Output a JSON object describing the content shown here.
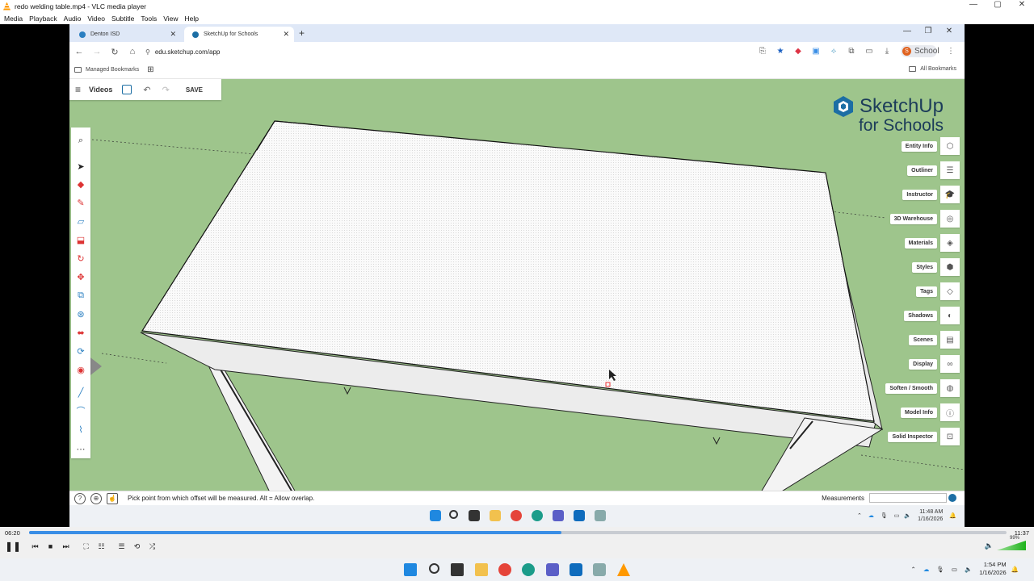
{
  "vlc": {
    "window_title": "redo welding table.mp4 - VLC media player",
    "menu": [
      "Media",
      "Playback",
      "Audio",
      "Video",
      "Subtitle",
      "Tools",
      "View",
      "Help"
    ],
    "elapsed": "06:20",
    "total": "11:37",
    "progress_fraction": 0.545,
    "volume_percent": "99%"
  },
  "browser": {
    "tabs": [
      {
        "label": "Denton ISD",
        "active": false
      },
      {
        "label": "SketchUp for Schools",
        "active": true
      }
    ],
    "url": "edu.sketchup.com/app",
    "profile_label": "School",
    "profile_initial": "S",
    "bookmarks_left": "Managed Bookmarks",
    "bookmarks_right": "All Bookmarks"
  },
  "sketchup": {
    "topbar": {
      "menu_label": "Videos",
      "save_label": "SAVE"
    },
    "brand_line1": "SketchUp",
    "brand_line2": "for Schools",
    "panels": [
      {
        "label": "Entity Info",
        "icon": "entity-info-icon",
        "glyph": "⬡"
      },
      {
        "label": "Outliner",
        "icon": "outliner-icon",
        "glyph": "☰"
      },
      {
        "label": "Instructor",
        "icon": "instructor-icon",
        "glyph": "🎓"
      },
      {
        "label": "3D Warehouse",
        "icon": "warehouse-icon",
        "glyph": "◎"
      },
      {
        "label": "Materials",
        "icon": "materials-icon",
        "glyph": "◈"
      },
      {
        "label": "Styles",
        "icon": "styles-icon",
        "glyph": "⬢"
      },
      {
        "label": "Tags",
        "icon": "tags-icon",
        "glyph": "◇"
      },
      {
        "label": "Shadows",
        "icon": "shadows-icon",
        "glyph": "◐"
      },
      {
        "label": "Scenes",
        "icon": "scenes-icon",
        "glyph": "▤"
      },
      {
        "label": "Display",
        "icon": "display-icon",
        "glyph": "∞"
      },
      {
        "label": "Soften / Smooth",
        "icon": "soften-icon",
        "glyph": "◍"
      },
      {
        "label": "Model Info",
        "icon": "model-info-icon",
        "glyph": "ⓘ"
      },
      {
        "label": "Solid Inspector",
        "icon": "solid-inspector-icon",
        "glyph": "⊡"
      }
    ],
    "tools": [
      {
        "name": "search-tool-icon",
        "glyph": "⌕",
        "color": "#333"
      },
      {
        "name": "select-tool-icon",
        "glyph": "➤",
        "color": "#222"
      },
      {
        "name": "eraser-tool-icon",
        "glyph": "◆",
        "color": "#d33"
      },
      {
        "name": "pencil-tool-icon",
        "glyph": "✎",
        "color": "#d33"
      },
      {
        "name": "rectangle-tool-icon",
        "glyph": "▱",
        "color": "#2a7fc1"
      },
      {
        "name": "push-pull-tool-icon",
        "glyph": "⬓",
        "color": "#d33"
      },
      {
        "name": "rotate-tool-icon",
        "glyph": "↻",
        "color": "#d33"
      },
      {
        "name": "move-tool-icon",
        "glyph": "✥",
        "color": "#d33"
      },
      {
        "name": "scale-tool-icon",
        "glyph": "⧉",
        "color": "#2a7fc1"
      },
      {
        "name": "offset-tool-icon",
        "glyph": "⊛",
        "color": "#2a7fc1"
      },
      {
        "name": "section-plane-tool-icon",
        "glyph": "⬌",
        "color": "#d33"
      },
      {
        "name": "orbit-tool-icon",
        "glyph": "⟳",
        "color": "#2a7fc1"
      },
      {
        "name": "paint-tool-icon",
        "glyph": "◉",
        "color": "#d33"
      },
      {
        "name": "line-tool-icon",
        "glyph": "╱",
        "color": "#2a7fc1"
      },
      {
        "name": "arc-tool-icon",
        "glyph": "⌒",
        "color": "#2a7fc1"
      },
      {
        "name": "freehand-tool-icon",
        "glyph": "⌇",
        "color": "#2a7fc1"
      },
      {
        "name": "more-tools-icon",
        "glyph": "⋯",
        "color": "#555"
      }
    ],
    "status_message": "Pick point from which offset will be measured. Alt = Allow overlap.",
    "measurements_label": "Measurements"
  },
  "inner_taskbar": {
    "time": "11:48 AM",
    "date": "1/16/2026"
  },
  "taskbar": {
    "time": "1:54 PM",
    "date": "1/16/2026"
  },
  "colors": {
    "viewport_bg": "#9ec58c",
    "accent": "#3a8ee6",
    "brand": "#1c3c5a"
  }
}
